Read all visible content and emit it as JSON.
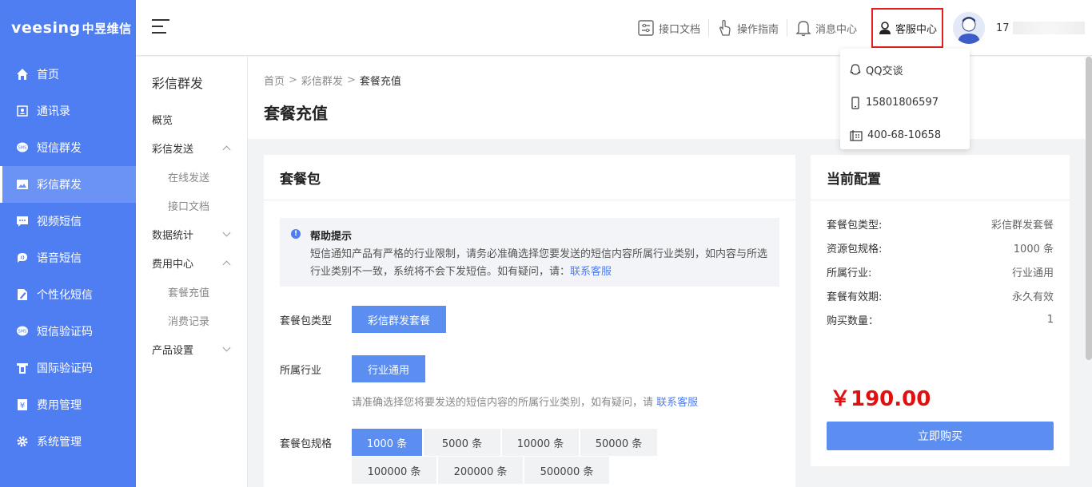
{
  "logo": {
    "text": "veesing",
    "cn": "中昱维信"
  },
  "nav": [
    {
      "label": "首页",
      "icon": "home-icon"
    },
    {
      "label": "通讯录",
      "icon": "contacts-icon"
    },
    {
      "label": "短信群发",
      "icon": "sms-icon"
    },
    {
      "label": "彩信群发",
      "icon": "mms-icon",
      "active": true
    },
    {
      "label": "视频短信",
      "icon": "video-sms-icon"
    },
    {
      "label": "语音短信",
      "icon": "voice-sms-icon"
    },
    {
      "label": "个性化短信",
      "icon": "personalized-sms-icon"
    },
    {
      "label": "短信验证码",
      "icon": "sms-code-icon"
    },
    {
      "label": "国际验证码",
      "icon": "intl-code-icon"
    },
    {
      "label": "费用管理",
      "icon": "yen-icon"
    },
    {
      "label": "系统管理",
      "icon": "gear-icon"
    }
  ],
  "topbar": {
    "api_docs": "接口文档",
    "guide": "操作指南",
    "messages": "消息中心",
    "service": "客服中心",
    "user_prefix": "17"
  },
  "dropdown": {
    "qq": "QQ交谈",
    "mobile": "15801806597",
    "hotline": "400-68-10658"
  },
  "subnav": {
    "title": "彩信群发",
    "items": [
      {
        "label": "概览",
        "type": "top"
      },
      {
        "label": "彩信发送",
        "type": "top",
        "chev": "up"
      },
      {
        "label": "在线发送",
        "type": "child"
      },
      {
        "label": "接口文档",
        "type": "child"
      },
      {
        "label": "数据统计",
        "type": "top",
        "chev": "down"
      },
      {
        "label": "费用中心",
        "type": "top",
        "chev": "up"
      },
      {
        "label": "套餐充值",
        "type": "child"
      },
      {
        "label": "消费记录",
        "type": "child"
      },
      {
        "label": "产品设置",
        "type": "top",
        "chev": "down"
      }
    ]
  },
  "breadcrumb": {
    "home": "首页",
    "section": "彩信群发",
    "current": "套餐充值"
  },
  "page_title": "套餐充值",
  "package": {
    "title": "套餐包",
    "tip_title": "帮助提示",
    "tip_text": "短信通知产品有严格的行业限制，请务必准确选择您要发送的短信内容所属行业类别，如内容与所选行业类别不一致，系统将不会下发短信。如有疑问，请：",
    "tip_link": "联系客服",
    "type_label": "套餐包类型",
    "type_value": "彩信群发套餐",
    "industry_label": "所属行业",
    "industry_value": "行业通用",
    "hint_text": "请准确选择您将要发送的短信内容的所属行业类别，如有疑问，请",
    "hint_link": "联系客服",
    "spec_label": "套餐包规格",
    "specs": [
      "1000 条",
      "5000 条",
      "10000 条",
      "50000 条",
      "100000 条",
      "200000 条",
      "500000 条"
    ],
    "selected_spec": "1000 条"
  },
  "config": {
    "title": "当前配置",
    "rows": [
      {
        "label": "套餐包类型:",
        "value": "彩信群发套餐"
      },
      {
        "label": "资源包规格:",
        "value": "1000 条"
      },
      {
        "label": "所属行业:",
        "value": "行业通用"
      },
      {
        "label": "套餐有效期:",
        "value": "永久有效"
      },
      {
        "label": "购买数量：",
        "value": "1"
      }
    ],
    "price": "￥190.00",
    "buy_label": "立即购买"
  }
}
